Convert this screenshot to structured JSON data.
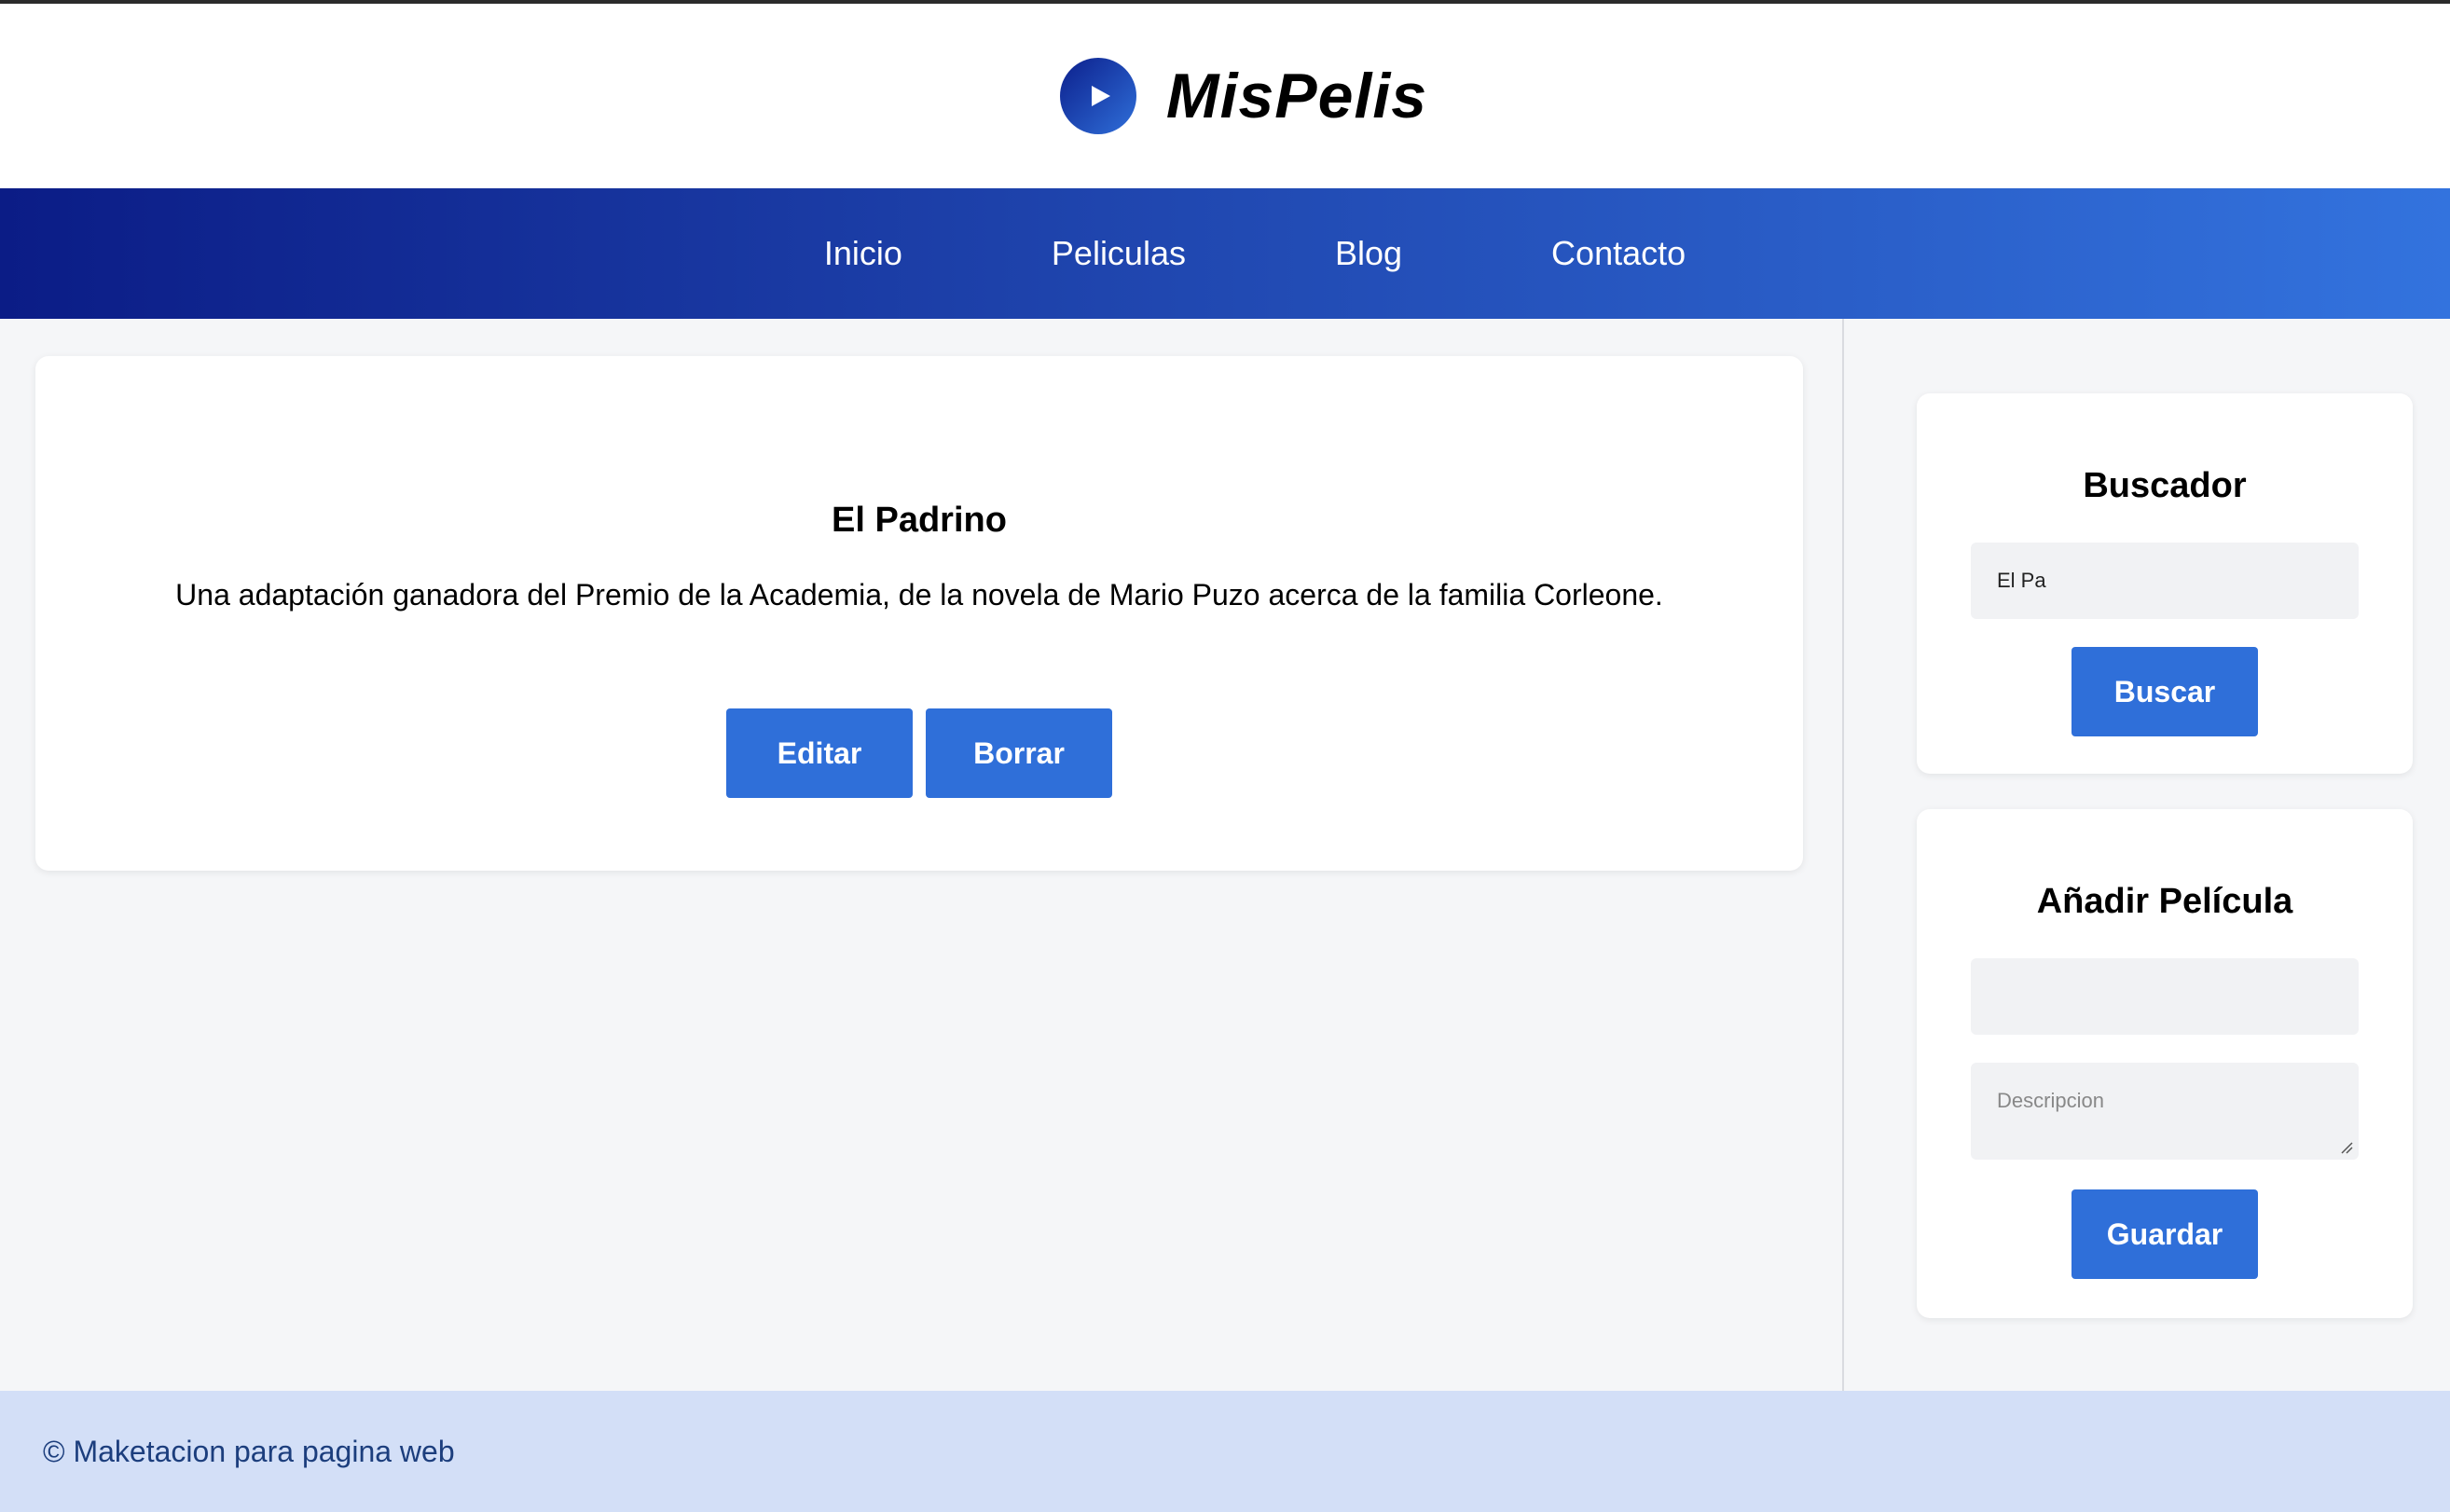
{
  "header": {
    "logo_text": "MisPelis",
    "logo_icon": "play-icon"
  },
  "nav": {
    "items": [
      {
        "label": "Inicio"
      },
      {
        "label": "Peliculas"
      },
      {
        "label": "Blog"
      },
      {
        "label": "Contacto"
      }
    ]
  },
  "movie": {
    "title": "El Padrino",
    "description": "Una adaptación ganadora del Premio de la Academia, de la novela de Mario Puzo acerca de la familia Corleone.",
    "edit_label": "Editar",
    "delete_label": "Borrar"
  },
  "search_widget": {
    "title": "Buscador",
    "input_value": "El Pa",
    "button_label": "Buscar"
  },
  "add_widget": {
    "title": "Añadir Película",
    "title_input_value": "",
    "description_placeholder": "Descripcion",
    "button_label": "Guardar"
  },
  "footer": {
    "text": "© Maketacion para pagina web"
  },
  "colors": {
    "primary_button": "#2f6fd9",
    "nav_gradient_start": "#0b1c86",
    "nav_gradient_end": "#3373de",
    "footer_bg": "#d3dff7",
    "footer_text": "#1c3e7d"
  }
}
